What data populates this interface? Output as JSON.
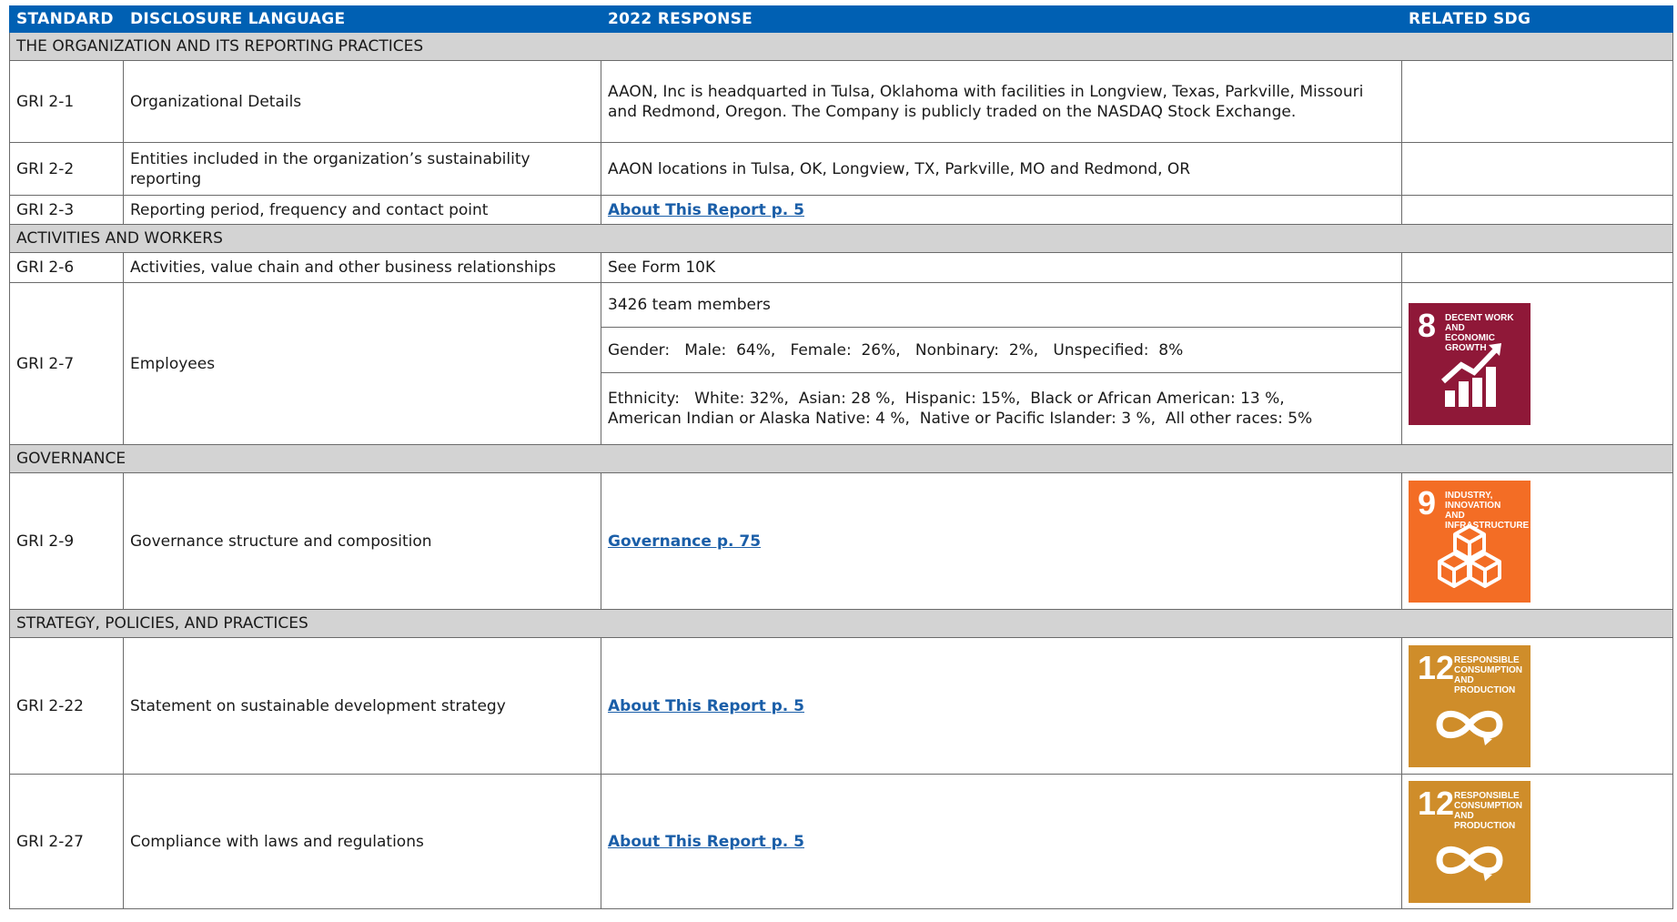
{
  "header": {
    "standard": "STANDARD",
    "disclosure": "DISCLOSURE LANGUAGE",
    "response": "2022 RESPONSE",
    "sdg": "RELATED SDG"
  },
  "sections": {
    "org": "THE ORGANIZATION AND ITS REPORTING PRACTICES",
    "activities": "ACTIVITIES AND WORKERS",
    "governance": "GOVERNANCE",
    "strategy": "STRATEGY, POLICIES, AND PRACTICES"
  },
  "rows": {
    "r21": {
      "std": "GRI 2-1",
      "disc": "Organizational Details",
      "resp": "AAON, Inc is headquarted in Tulsa, Oklahoma with facilities in Longview, Texas, Parkville, Missouri and Redmond, Oregon. The Company is publicly traded on the NASDAQ Stock Exchange."
    },
    "r22": {
      "std": "GRI 2-2",
      "disc": "Entities included in the organization’s sustainability reporting",
      "resp": "AAON locations in Tulsa, OK, Longview, TX, Parkville, MO and Redmond, OR"
    },
    "r23": {
      "std": "GRI 2-3",
      "disc": "Reporting period, frequency and contact point",
      "resp": "About This Report p. 5"
    },
    "r26": {
      "std": "GRI 2-6",
      "disc": "Activities, value chain and other business relationships",
      "resp": "See Form 10K"
    },
    "r27": {
      "std": "GRI 2-7",
      "disc": "Employees",
      "resp_team": "3426 team members",
      "resp_gender": "Gender:   Male:  64%,   Female:  26%,   Nonbinary:  2%,   Unspecified:  8%",
      "resp_eth_1": "Ethnicity:   White: 32%,  Asian: 28 %,  Hispanic: 15%,  Black or African American: 13 %,",
      "resp_eth_2": "American Indian or Alaska Native: 4 %,  Native or Pacific Islander: 3 %,  All other races: 5%"
    },
    "r29": {
      "std": "GRI 2-9",
      "disc": "Governance structure and composition",
      "resp": "Governance p. 75"
    },
    "r222": {
      "std": "GRI 2-22",
      "disc": "Statement on sustainable development strategy",
      "resp": "About This Report p. 5"
    },
    "r227": {
      "std": "GRI 2-27",
      "disc": "Compliance with laws and regulations",
      "resp": "About This Report p. 5"
    }
  },
  "sdg_tiles": {
    "sdg8": {
      "num": "8",
      "text": "DECENT WORK AND\nECONOMIC GROWTH",
      "color": "#8f1838",
      "icon": "growth-chart-icon"
    },
    "sdg9": {
      "num": "9",
      "text": "INDUSTRY, INNOVATION\nAND INFRASTRUCTURE",
      "color": "#f36d25",
      "icon": "cubes-icon"
    },
    "sdg12": {
      "num": "12",
      "text": "RESPONSIBLE\nCONSUMPTION\nAND PRODUCTION",
      "color": "#cf8d2a",
      "icon": "infinity-icon"
    }
  }
}
